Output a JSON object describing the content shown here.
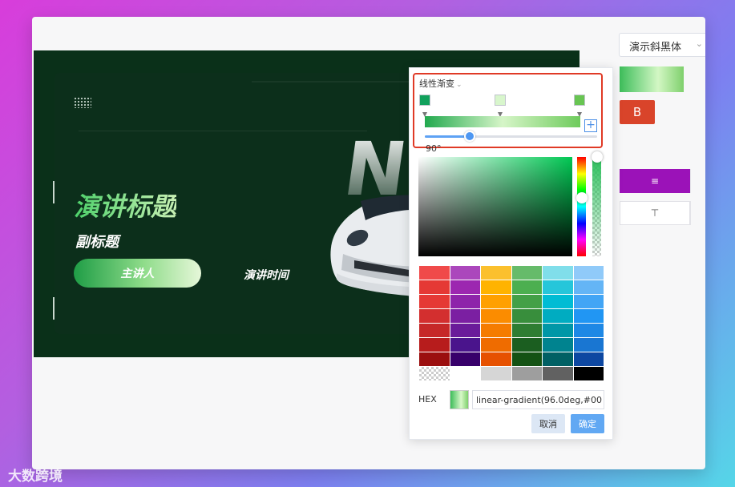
{
  "slide": {
    "title": "演讲标题",
    "subtitle": "副标题",
    "speaker": "主讲人",
    "time": "演讲时间",
    "watermark_letters": "N"
  },
  "panel": {
    "font_name": "演示斜黑体",
    "bold_label": "B",
    "align_icon": "≡",
    "valign_icon": "⊤"
  },
  "picker": {
    "gradient_type": "线性渐变",
    "angle": "90°",
    "hex_label": "HEX",
    "hex_value": "linear-gradient(96.0deg,#00",
    "cancel": "取消",
    "confirm": "确定",
    "stops": [
      {
        "color": "#11a15c"
      },
      {
        "color": "#d8f6cc"
      },
      {
        "color": "#68c552"
      }
    ],
    "palette": [
      "#f04a4a",
      "#ab47bc",
      "#fbc02d",
      "#66bb6a",
      "#80deea",
      "#90caf9",
      "#e53935",
      "#9c27b0",
      "#ffb300",
      "#4caf50",
      "#26c6da",
      "#64b5f6",
      "#e53935",
      "#8e24aa",
      "#ffa000",
      "#43a047",
      "#00bcd4",
      "#42a5f5",
      "#d32f2f",
      "#7b1fa2",
      "#fb8c00",
      "#388e3c",
      "#00acc1",
      "#2196f3",
      "#c62828",
      "#6a1b9a",
      "#f57c00",
      "#2e7d32",
      "#0097a7",
      "#1e88e5",
      "#b71c1c",
      "#4a148c",
      "#ef6c00",
      "#1b5e20",
      "#00838f",
      "#1976d2",
      "#9b0f0f",
      "#38006b",
      "#e65100",
      "#145214",
      "#006064",
      "#0d47a1",
      "transparent",
      "#ffffff",
      "#d6d6d6",
      "#9e9e9e",
      "#616161",
      "#000000"
    ]
  },
  "watermark": "大数跨境"
}
